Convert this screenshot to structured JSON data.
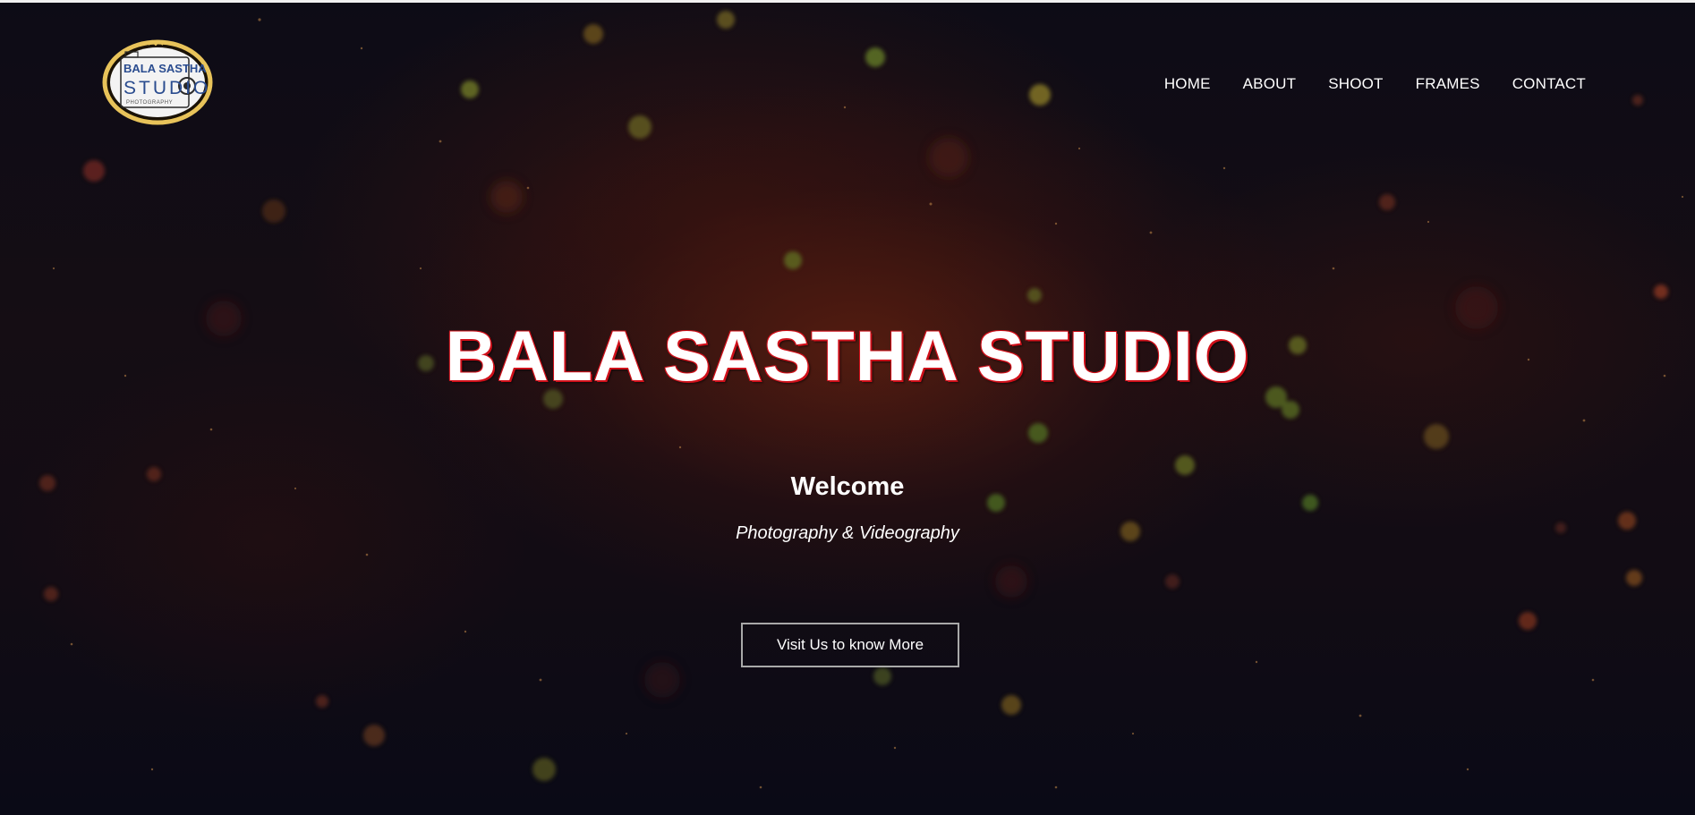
{
  "brand": {
    "logo_line1": "BALA SASTHA",
    "logo_line2": "STUDIO",
    "logo_line3": "PHOTOGRAPHY",
    "title": "BALA SASTHA STUDIO"
  },
  "nav": {
    "items": [
      "HOME",
      "ABOUT",
      "SHOOT",
      "FRAMES",
      "CONTACT"
    ]
  },
  "hero": {
    "welcome": "Welcome",
    "tagline": "Photography & Videography",
    "cta_label": "Visit Us to know More"
  },
  "colors": {
    "title_outline": "#d0101a",
    "logo_ring": "#e8c35a",
    "logo_text": "#2a4c8f"
  }
}
